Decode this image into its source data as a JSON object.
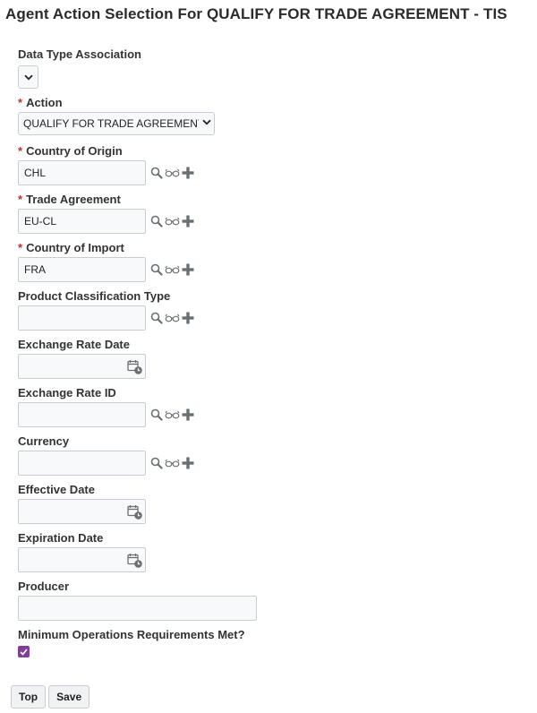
{
  "page": {
    "title": "Agent Action Selection For QUALIFY FOR TRADE AGREEMENT - TIS"
  },
  "required_marker": "*",
  "fields": {
    "data_type_association": {
      "label": "Data Type Association",
      "value": ""
    },
    "action": {
      "label": "Action",
      "value": "QUALIFY FOR TRADE AGREEMENT"
    },
    "country_of_origin": {
      "label": "Country of Origin",
      "value": "CHL"
    },
    "trade_agreement": {
      "label": "Trade Agreement",
      "value": "EU-CL"
    },
    "country_of_import": {
      "label": "Country of Import",
      "value": "FRA"
    },
    "product_classification_type": {
      "label": "Product Classification Type",
      "value": ""
    },
    "exchange_rate_date": {
      "label": "Exchange Rate Date",
      "value": ""
    },
    "exchange_rate_id": {
      "label": "Exchange Rate ID",
      "value": ""
    },
    "currency": {
      "label": "Currency",
      "value": ""
    },
    "effective_date": {
      "label": "Effective Date",
      "value": ""
    },
    "expiration_date": {
      "label": "Expiration Date",
      "value": ""
    },
    "producer": {
      "label": "Producer",
      "value": ""
    },
    "minimum_operations_requirements_met": {
      "label": "Minimum Operations Requirements Met?",
      "checked": true
    }
  },
  "buttons": {
    "top": "Top",
    "save": "Save"
  },
  "icons": {
    "search": "search-icon",
    "view": "glasses-icon",
    "add": "plus-icon",
    "calendar": "calendar-icon",
    "dropdown": "chevron-down-icon"
  },
  "colors": {
    "required": "#c0312b",
    "checkbox": "#7d3f98",
    "icon": "#6b6f74"
  }
}
